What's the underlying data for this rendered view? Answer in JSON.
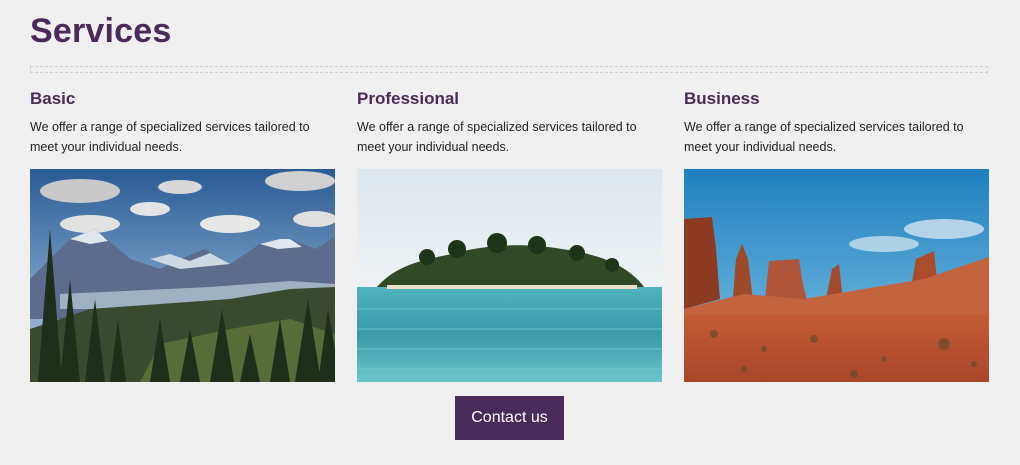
{
  "page": {
    "title": "Services"
  },
  "services": [
    {
      "title": "Basic",
      "description": "We offer a range of specialized services tailored to meet your individual needs.",
      "image": "mountain-forest-landscape"
    },
    {
      "title": "Professional",
      "description": "We offer a range of specialized services tailored to meet your individual needs.",
      "image": "tropical-island-ocean"
    },
    {
      "title": "Business",
      "description": "We offer a range of specialized services tailored to meet your individual needs.",
      "image": "desert-canyon-landscape"
    }
  ],
  "cta": {
    "label": "Contact us"
  },
  "colors": {
    "accent": "#4a2a5a",
    "background": "#f0f0f0"
  }
}
